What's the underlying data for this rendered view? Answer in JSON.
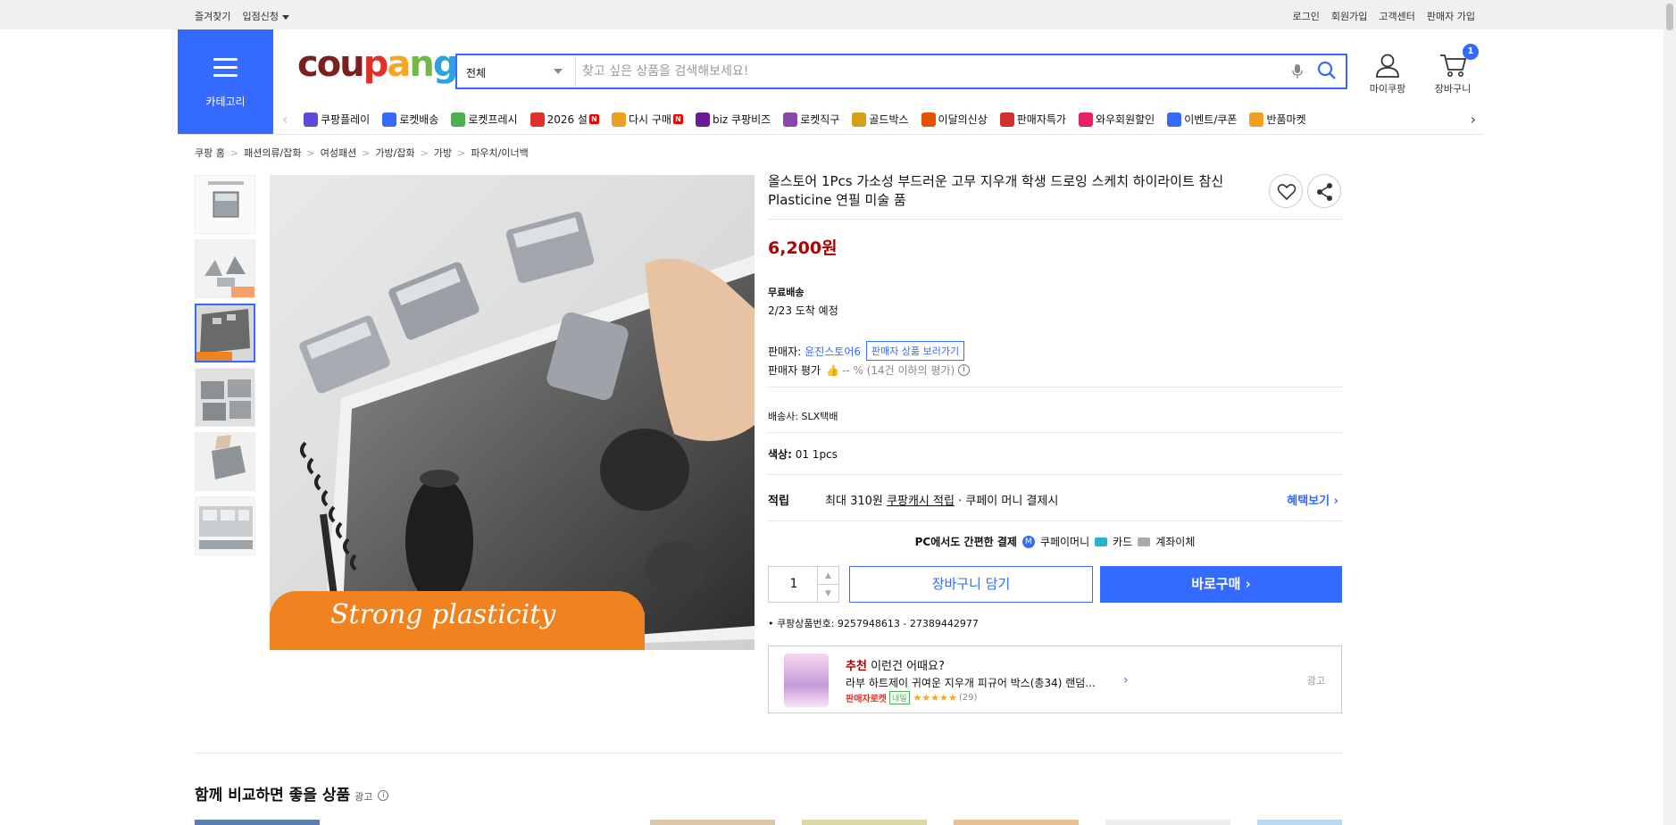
{
  "topbar": {
    "left": [
      "즐겨찾기",
      "입점신청"
    ],
    "right": [
      "로그인",
      "회원가입",
      "고객센터",
      "판매자 가입"
    ]
  },
  "header": {
    "category_label": "카테고리",
    "logo_text": "coupang",
    "search_scope": "전체",
    "search_placeholder": "찾고 싶은 상품을 검색해보세요!",
    "mypage_label": "마이쿠팡",
    "cart_label": "장바구니",
    "cart_count": "1"
  },
  "menu": [
    {
      "label": "쿠팡플레이",
      "icon": "play-icon",
      "color": "#5b4bdb"
    },
    {
      "label": "로켓배송",
      "icon": "rocket-icon",
      "color": "#346aff"
    },
    {
      "label": "로켓프레시",
      "icon": "rocket-fresh-icon",
      "color": "#4caf50"
    },
    {
      "label": "2026 설",
      "icon": "gift-icon",
      "color": "#e0302a",
      "badge": "N"
    },
    {
      "label": "다시 구매",
      "icon": "home-icon",
      "color": "#f0a020",
      "badge": "N"
    },
    {
      "label": "biz 쿠팡비즈",
      "icon": "biz-icon",
      "color": "#6a1b9a"
    },
    {
      "label": "로켓직구",
      "icon": "global-icon",
      "color": "#8e44ad"
    },
    {
      "label": "골드박스",
      "icon": "goldbox-icon",
      "color": "#d4a017"
    },
    {
      "label": "이달의신상",
      "icon": "bag-icon",
      "color": "#e65100"
    },
    {
      "label": "판매자특가",
      "icon": "percent-icon",
      "color": "#d32f2f"
    },
    {
      "label": "와우회원할인",
      "icon": "wow-icon",
      "color": "#e91e63"
    },
    {
      "label": "이벤트/쿠폰",
      "icon": "coupon-icon",
      "color": "#346aff"
    },
    {
      "label": "반품마켓",
      "icon": "market-icon",
      "color": "#f0a020"
    }
  ],
  "breadcrumb": [
    "쿠팡 홈",
    "패션의류/잡화",
    "여성패션",
    "가방/잡화",
    "가방",
    "파우치/이너백"
  ],
  "product": {
    "title": "올스토어 1Pcs 가소성 부드러운 고무 지우개 학생 드로잉 스케치 하이라이트 참신 Plasticine 연필 미술 품",
    "price": "6,200원",
    "shipping_type": "무료배송",
    "arrival": "2/23 도착 예정",
    "seller_label": "판매자:",
    "seller_name": "윤진스토어6",
    "seller_btn": "판매자 상품 보러가기",
    "rating_label": "판매자 평가",
    "rating_value": "-- % (14건 이하의 평가)",
    "courier": "배송사:  SLX택배",
    "color_label": "색상:",
    "color_value": "01 1pcs",
    "reward_label": "적립",
    "reward_text1": "최대 310원",
    "reward_link": "쿠팡캐시 적립",
    "reward_text2": "· 쿠페이 머니 결제시",
    "benefit_link": "혜택보기 ›",
    "pcpay_label": "PC에서도 간편한 결제",
    "pay_methods": [
      "쿠페이머니",
      "카드",
      "계좌이체"
    ],
    "quantity": "1",
    "add_cart": "장바구니 담기",
    "buy_now": "바로구매 ›",
    "product_id": "쿠팡상품번호: 9257948613 - 27389442977",
    "image_caption": "Strong plasticity"
  },
  "recommend": {
    "title_red": "추천",
    "title_rest": "이런건 어때요?",
    "item": "라부 하트제이 귀여운 지우개 피규어 박스(총34) 랜덤...",
    "badge": "판매자로켓",
    "badge2": "내일",
    "reviews": "(29)",
    "ad": "광고"
  },
  "compare": {
    "title": "함께 비교하면 좋을 상품",
    "ad": "광고"
  }
}
